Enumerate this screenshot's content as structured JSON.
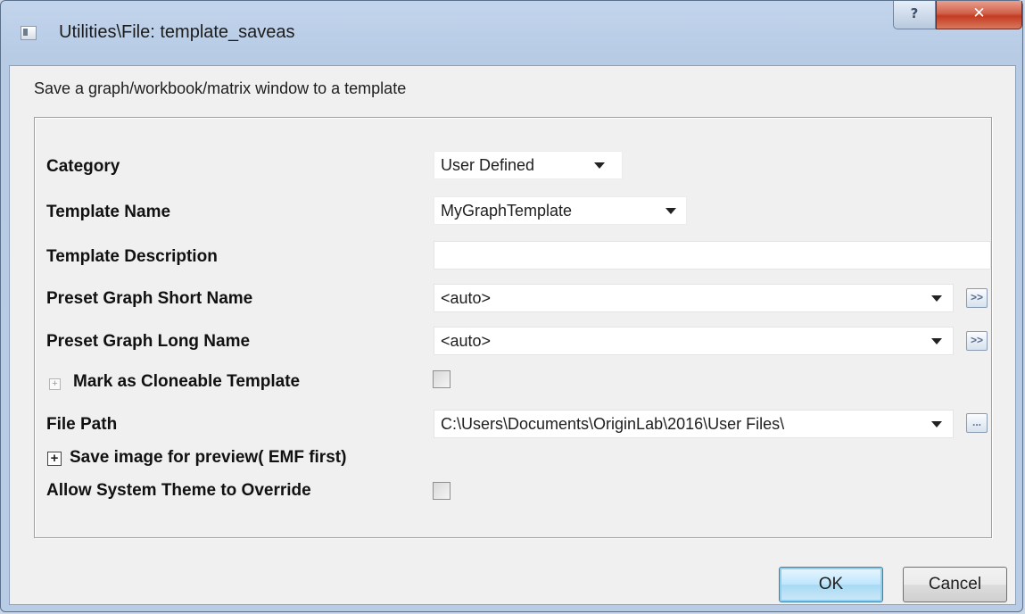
{
  "window": {
    "title": "Utilities\\File: template_saveas",
    "help_glyph": "?",
    "close_glyph": "✕"
  },
  "dialog": {
    "description": "Save a graph/workbook/matrix window to a template"
  },
  "fields": {
    "category": {
      "label": "Category",
      "value": "User Defined"
    },
    "template_name": {
      "label": "Template Name",
      "value": "MyGraphTemplate"
    },
    "template_description": {
      "label": "Template Description",
      "value": ""
    },
    "preset_short_name": {
      "label": "Preset Graph Short Name",
      "value": "<auto>",
      "button": ">>"
    },
    "preset_long_name": {
      "label": "Preset Graph Long Name",
      "value": "<auto>",
      "button": ">>"
    },
    "cloneable": {
      "label": "Mark as Cloneable Template",
      "checked": false
    },
    "file_path": {
      "label": "File Path",
      "value": "C:\\Users\\Documents\\OriginLab\\2016\\User Files\\",
      "button": "..."
    },
    "save_image": {
      "label": "Save image for preview( EMF first)"
    },
    "allow_theme": {
      "label": "Allow System Theme to Override",
      "checked": false
    }
  },
  "buttons": {
    "ok": "OK",
    "cancel": "Cancel"
  },
  "icons": {
    "app": "dialog-app-icon",
    "expand_small": "expand-icon",
    "expand_large": "expand-plus-icon"
  }
}
